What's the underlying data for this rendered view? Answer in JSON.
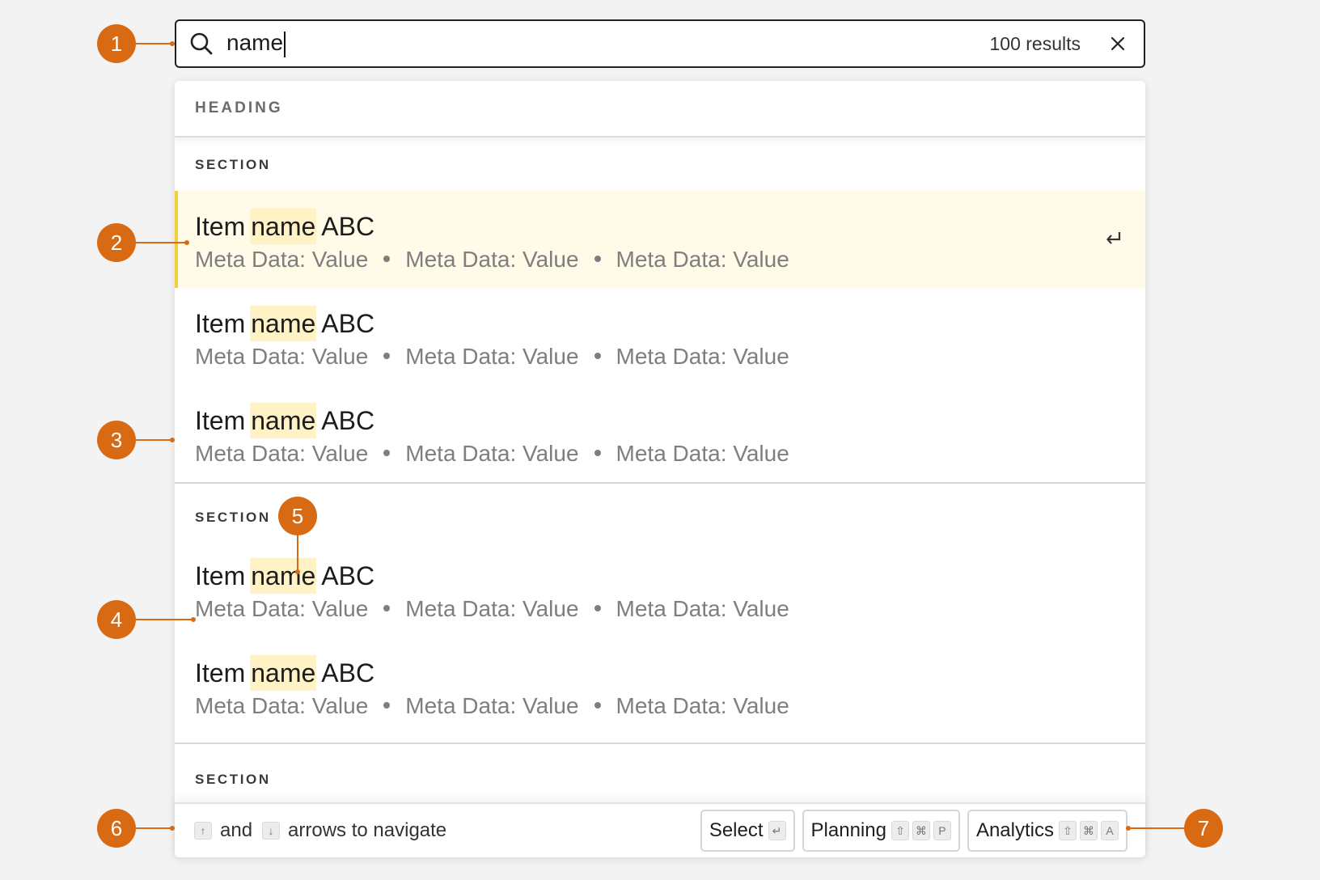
{
  "search": {
    "query": "name",
    "results_count": "100 results",
    "icon": "search-icon",
    "clear_icon": "close-icon"
  },
  "panel": {
    "heading": "HEADING",
    "sections": [
      {
        "label": "SECTION",
        "items": [
          {
            "prefix": "Item",
            "match": "name",
            "suffix": "ABC",
            "meta": [
              "Meta Data: Value",
              "Meta Data: Value",
              "Meta Data: Value"
            ],
            "selected": true
          },
          {
            "prefix": "Item",
            "match": "name",
            "suffix": "ABC",
            "meta": [
              "Meta Data: Value",
              "Meta Data: Value",
              "Meta Data: Value"
            ]
          },
          {
            "prefix": "Item",
            "match": "name",
            "suffix": "ABC",
            "meta": [
              "Meta Data: Value",
              "Meta Data: Value",
              "Meta Data: Value"
            ]
          }
        ]
      },
      {
        "label": "SECTION",
        "items": [
          {
            "prefix": "Item",
            "match": "name",
            "suffix": "ABC",
            "meta": [
              "Meta Data: Value",
              "Meta Data: Value",
              "Meta Data: Value"
            ]
          },
          {
            "prefix": "Item",
            "match": "name",
            "suffix": "ABC",
            "meta": [
              "Meta Data: Value",
              "Meta Data: Value",
              "Meta Data: Value"
            ]
          }
        ]
      },
      {
        "label": "SECTION",
        "items": []
      }
    ]
  },
  "footer": {
    "up_key": "↑",
    "and_text": "and",
    "down_key": "↓",
    "navigate_text": "arrows to navigate",
    "shortcuts": [
      {
        "label": "Select",
        "keys": [
          "↵"
        ]
      },
      {
        "label": "Planning",
        "keys": [
          "⇧",
          "⌘",
          "P"
        ]
      },
      {
        "label": "Analytics",
        "keys": [
          "⇧",
          "⌘",
          "A"
        ]
      }
    ]
  },
  "callouts": [
    "1",
    "2",
    "3",
    "4",
    "5",
    "6",
    "7"
  ],
  "colors": {
    "accent": "#d96a14",
    "highlight": "#fff2c4",
    "selected_bg": "#fffbe8",
    "selected_border": "#f2cf3a"
  }
}
